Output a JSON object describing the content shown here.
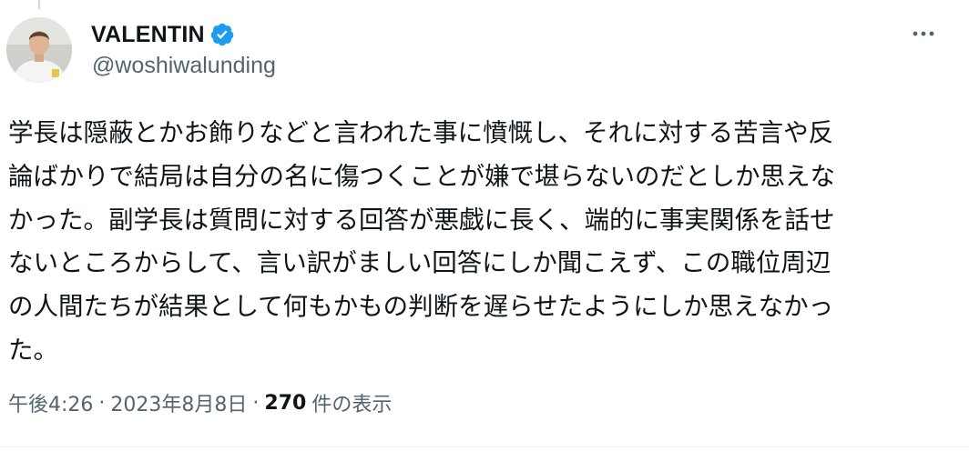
{
  "author": {
    "display_name": "VALENTIN",
    "handle": "@woshiwalunding",
    "verified": true
  },
  "tweet": {
    "text": "学長は隠蔽とかお飾りなどと言われた事に憤慨し、それに対する苦言や反\n論ばかりで結局は自分の名に傷つくことが嫌で堪らないのだとしか思えな\nかった。副学長は質問に対する回答が悪戯に長く、端的に事実関係を話せ\nないところからして、言い訳がましい回答にしか聞こえず、この職位周辺\nの人間たちが結果として何もかもの判断を遅らせたようにしか思えなかっ\nた。"
  },
  "meta": {
    "time": "午後4:26",
    "separator": "·",
    "date": "2023年8月8日",
    "view_count": "270",
    "view_label": "件の表示"
  },
  "colors": {
    "verified": "#1d9bf0",
    "secondary_text": "#536471",
    "primary_text": "#0f1419"
  },
  "icons": {
    "verified": "verified-badge-icon",
    "more": "more-options-icon"
  }
}
